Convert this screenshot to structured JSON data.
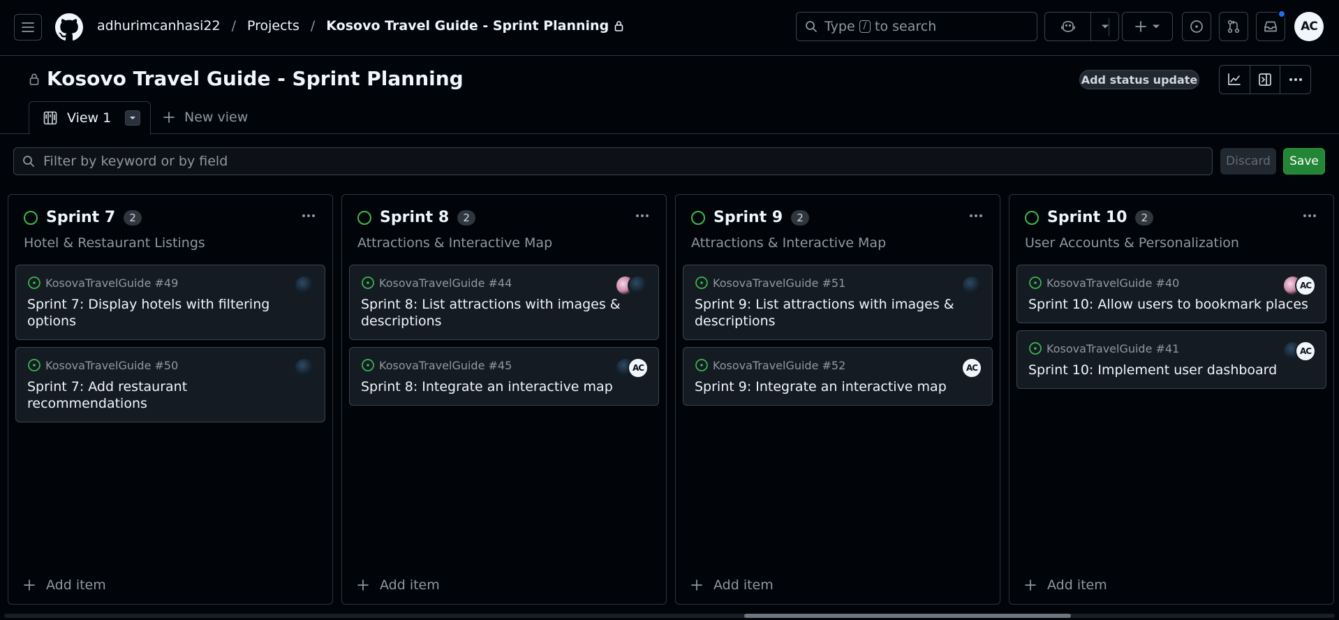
{
  "header": {
    "owner": "adhurimcanhasi22",
    "projects": "Projects",
    "project": "Kosovo Travel Guide - Sprint Planning",
    "search_prefix": "Type",
    "search_key": "/",
    "search_suffix": "to search",
    "user_initials": "AC"
  },
  "project": {
    "title": "Kosovo Travel Guide - Sprint Planning",
    "status_button": "Add status update"
  },
  "tabs": {
    "active": "View 1",
    "new_view": "New view"
  },
  "filter": {
    "placeholder": "Filter by keyword or by field",
    "discard": "Discard",
    "save": "Save"
  },
  "columns": [
    {
      "name": "Sprint 7",
      "count": "2",
      "description": "Hotel & Restaurant Listings",
      "add_item": "Add item",
      "cards": [
        {
          "repo": "KosovaTravelGuide #49",
          "title": "Sprint 7: Display hotels with filtering options"
        },
        {
          "repo": "KosovaTravelGuide #50",
          "title": "Sprint 7: Add restaurant recommendations"
        }
      ]
    },
    {
      "name": "Sprint 8",
      "count": "2",
      "description": "Attractions & Interactive Map",
      "add_item": "Add item",
      "cards": [
        {
          "repo": "KosovaTravelGuide #44",
          "title": "Sprint 8: List attractions with images & descriptions"
        },
        {
          "repo": "KosovaTravelGuide #45",
          "title": "Sprint 8: Integrate an interactive map"
        }
      ]
    },
    {
      "name": "Sprint 9",
      "count": "2",
      "description": "Attractions & Interactive Map",
      "add_item": "Add item",
      "cards": [
        {
          "repo": "KosovaTravelGuide #51",
          "title": "Sprint 9: List attractions with images & descriptions"
        },
        {
          "repo": "KosovaTravelGuide #52",
          "title": "Sprint 9: Integrate an interactive map"
        }
      ]
    },
    {
      "name": "Sprint 10",
      "count": "2",
      "description": "User Accounts & Personalization",
      "add_item": "Add item",
      "cards": [
        {
          "repo": "KosovaTravelGuide #40",
          "title": "Sprint 10: Allow users to bookmark places"
        },
        {
          "repo": "KosovaTravelGuide #41",
          "title": "Sprint 10: Implement user dashboard"
        }
      ]
    }
  ],
  "avatar_initials": "AC",
  "colors": {
    "background": "#010409",
    "card": "#151b23",
    "border": "#3d444d",
    "open_status": "#3fb950",
    "save_button": "#238636",
    "notification": "#1f6feb"
  }
}
